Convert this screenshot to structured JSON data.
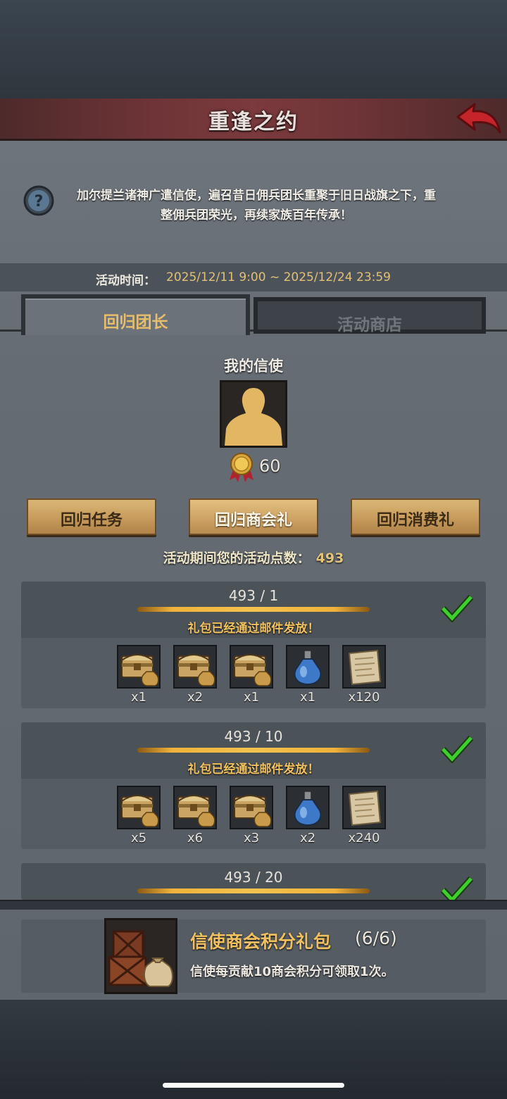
{
  "header": {
    "title": "重逢之约"
  },
  "description": {
    "line1": "加尔提兰诸神广遣信使，遍召昔日佣兵团长重聚于旧日战旗之下，重",
    "line2": "整佣兵团荣光，再续家族百年传承！"
  },
  "time": {
    "label": "活动时间：",
    "value": "2025/12/11 9:00 ~ 2025/12/24 23:59"
  },
  "tabs": [
    {
      "label": "回归团长"
    },
    {
      "label": "活动商店"
    }
  ],
  "messenger": {
    "title": "我的信使",
    "score": "60"
  },
  "buttons": [
    {
      "label": "回归任务"
    },
    {
      "label": "回归商会礼"
    },
    {
      "label": "回归消费礼"
    }
  ],
  "points": {
    "label": "活动期间您的活动点数：",
    "value": "493"
  },
  "rewards": [
    {
      "progress": "493 / 1",
      "status": "礼包已经通过邮件发放！",
      "items": [
        "chest-icon",
        "chest-icon",
        "chest-icon",
        "potion-icon",
        "scroll-icon"
      ],
      "qty": [
        "x1",
        "x2",
        "x1",
        "x1",
        "x120"
      ]
    },
    {
      "progress": "493 / 10",
      "status": "礼包已经通过邮件发放！",
      "items": [
        "chest-icon",
        "chest-icon",
        "chest-icon",
        "potion-icon",
        "scroll-icon"
      ],
      "qty": [
        "x5",
        "x6",
        "x3",
        "x2",
        "x240"
      ]
    },
    {
      "progress": "493 / 20"
    }
  ],
  "pack": {
    "title": "信使商会积分礼包",
    "count": "(6/6)",
    "desc": "信使每贡献10商会积分可领取1次。"
  },
  "colors": {
    "accent_gold": "#e7bf6b",
    "header_red": "#7b3a3d",
    "check_green": "#3fd12b"
  }
}
